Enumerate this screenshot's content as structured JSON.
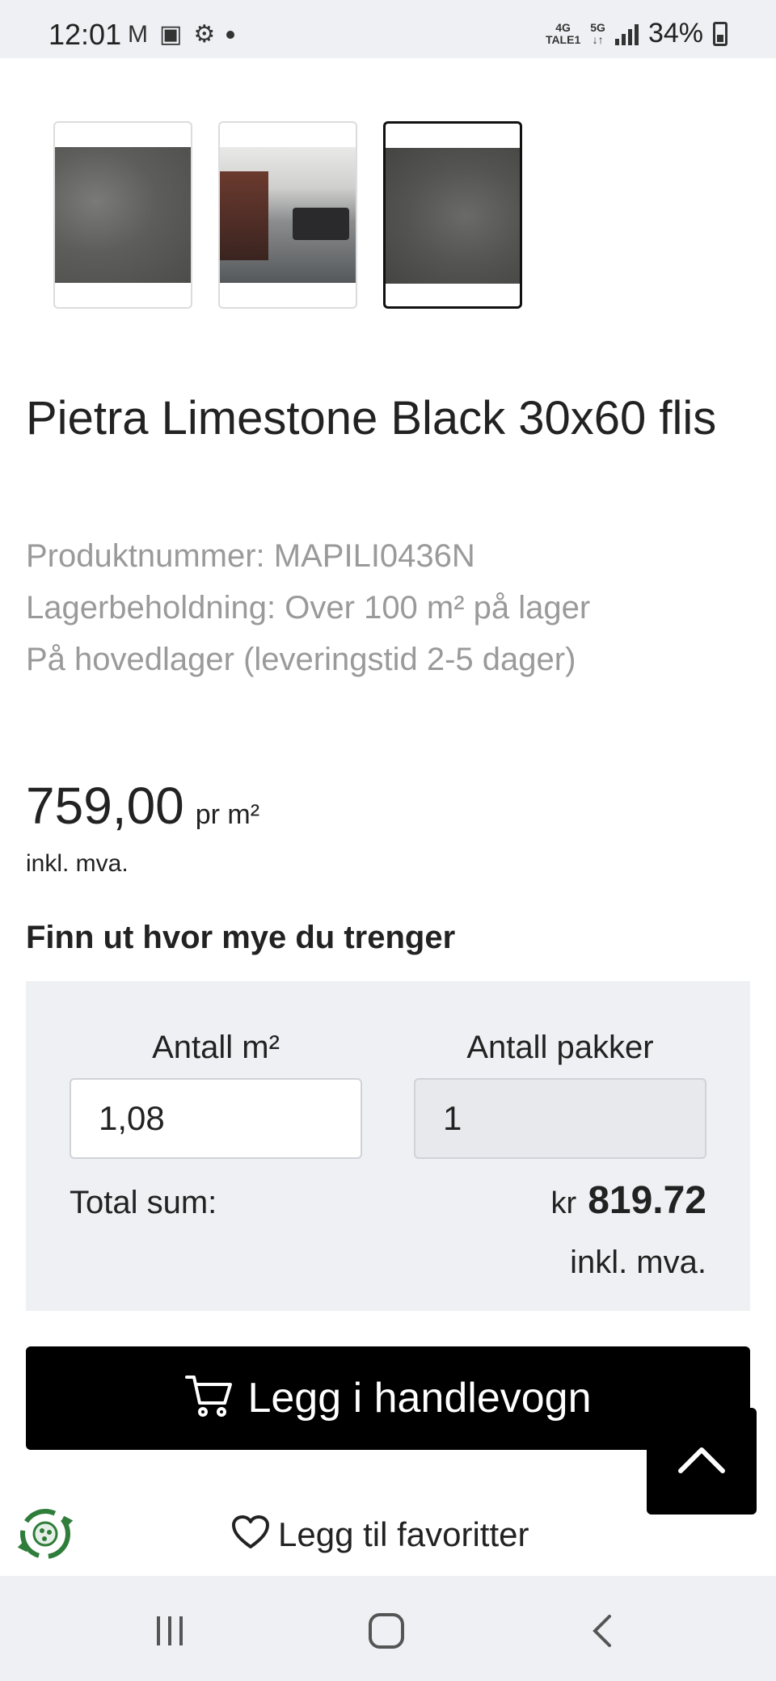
{
  "status_bar": {
    "time": "12:01",
    "network_4g": "4G",
    "network_tale": "TALE1",
    "network_5g": "5G",
    "battery": "34%"
  },
  "gallery": {
    "thumbnails": [
      {
        "name": "stone-texture"
      },
      {
        "name": "room-scene"
      },
      {
        "name": "stone-texture-dark",
        "selected": true
      }
    ]
  },
  "product": {
    "title": "Pietra Limestone Black 30x60 flis",
    "product_number": "Produktnummer: MAPILI0436N",
    "stock": "Lagerbeholdning: Over 100 m² på lager",
    "warehouse": "På hovedlager (leveringstid 2-5 dager)",
    "price": "759,00",
    "price_unit": "pr m²",
    "vat_note": "inkl. mva."
  },
  "calculator": {
    "heading": "Finn ut hvor mye du trenger",
    "area_label": "Antall m²",
    "area_value": "1,08",
    "packs_label": "Antall pakker",
    "packs_value": "1",
    "total_label": "Total sum:",
    "currency": "kr",
    "total_value": "819.72",
    "vat_note": "inkl. mva."
  },
  "actions": {
    "add_to_cart": "Legg i handlevogn",
    "add_to_favorites": "Legg til favoritter"
  },
  "colors": {
    "primary_button": "#000000",
    "panel_bg": "#eef0f3",
    "muted_text": "#9a9a9a",
    "eco_green": "#2f7d3a"
  }
}
